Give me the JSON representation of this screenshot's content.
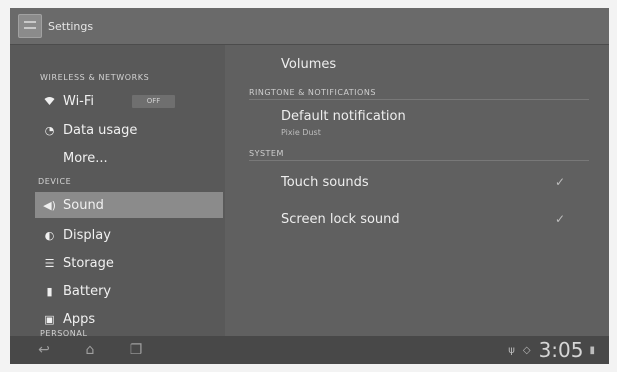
{
  "action_bar": {
    "title": "Settings",
    "icon": "settings-icon"
  },
  "left_nav": {
    "sections": [
      {
        "header": "WIRELESS & NETWORKS",
        "items": [
          {
            "label": "Wi-Fi",
            "icon": "wifi-icon",
            "toggle": "OFF"
          },
          {
            "label": "Data usage",
            "icon": "data-usage-icon"
          },
          {
            "label": "More...",
            "icon": ""
          }
        ]
      },
      {
        "header": "DEVICE",
        "items": [
          {
            "label": "Sound",
            "icon": "speaker-icon",
            "selected": true
          },
          {
            "label": "Display",
            "icon": "display-icon"
          },
          {
            "label": "Storage",
            "icon": "storage-icon"
          },
          {
            "label": "Battery",
            "icon": "battery-icon"
          },
          {
            "label": "Apps",
            "icon": "apps-icon"
          }
        ]
      },
      {
        "header": "PERSONAL",
        "items": []
      }
    ]
  },
  "detail": {
    "volumes_label": "Volumes",
    "ringtone_header": "RINGTONE & NOTIFICATIONS",
    "default_notification": {
      "title": "Default notification",
      "subtitle": "Pixie Dust"
    },
    "system_header": "SYSTEM",
    "touch_sounds": {
      "label": "Touch sounds",
      "checked": true
    },
    "screen_lock_sound": {
      "label": "Screen lock sound",
      "checked": true
    }
  },
  "system_bar": {
    "nav": [
      "back-icon",
      "home-icon",
      "recent-apps-icon"
    ],
    "time": "3:05"
  }
}
